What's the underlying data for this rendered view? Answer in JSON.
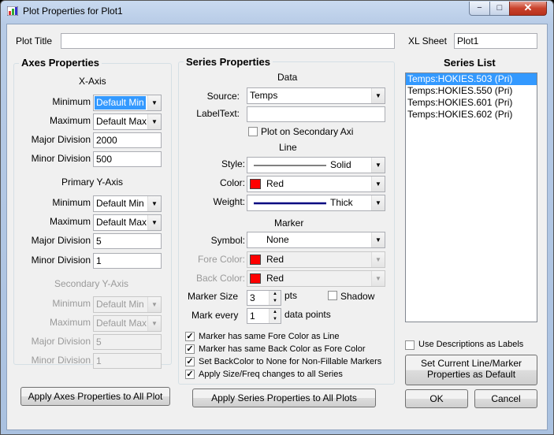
{
  "window": {
    "title": "Plot Properties for Plot1",
    "minimize_glyph": "−",
    "maximize_glyph": "□",
    "close_glyph": "✕"
  },
  "top": {
    "plot_title_label": "Plot Title",
    "plot_title_value": "",
    "xl_sheet_label": "XL Sheet",
    "xl_sheet_value": "Plot1"
  },
  "axes": {
    "group_title": "Axes Properties",
    "x_axis": {
      "heading": "X-Axis",
      "minimum_label": "Minimum",
      "minimum_value": "Default Min",
      "maximum_label": "Maximum",
      "maximum_value": "Default Max",
      "major_label": "Major Division",
      "major_value": "2000",
      "minor_label": "Minor Division",
      "minor_value": "500"
    },
    "primary_y": {
      "heading": "Primary Y-Axis",
      "minimum_label": "Minimum",
      "minimum_value": "Default Min",
      "maximum_label": "Maximum",
      "maximum_value": "Default Max",
      "major_label": "Major Division",
      "major_value": "5",
      "minor_label": "Minor Division",
      "minor_value": "1"
    },
    "secondary_y": {
      "heading": "Secondary Y-Axis",
      "minimum_label": "Minimum",
      "minimum_value": "Default Min",
      "maximum_label": "Maximum",
      "maximum_value": "Default Max",
      "major_label": "Major Division",
      "major_value": "5",
      "minor_label": "Minor Division",
      "minor_value": "1"
    },
    "apply_button": "Apply Axes Properties to All Plot"
  },
  "series": {
    "group_title": "Series Properties",
    "data_heading": "Data",
    "source_label": "Source:",
    "source_value": "Temps",
    "label_text_label": "LabelText:",
    "label_text_value": "",
    "secondary_axis_label": "Plot on Secondary Axi",
    "line_heading": "Line",
    "style_label": "Style:",
    "style_value": "Solid",
    "color_label": "Color:",
    "color_value": "Red",
    "weight_label": "Weight:",
    "weight_value": "Thick",
    "marker_heading": "Marker",
    "symbol_label": "Symbol:",
    "symbol_value": "None",
    "fore_color_label": "Fore Color:",
    "fore_color_value": "Red",
    "back_color_label": "Back Color:",
    "back_color_value": "Red",
    "marker_size_label": "Marker Size",
    "marker_size_value": "3",
    "marker_size_unit": "pts",
    "shadow_label": "Shadow",
    "mark_every_label": "Mark every",
    "mark_every_value": "1",
    "mark_every_unit": "data points",
    "checks": [
      "Marker has same Fore Color as Line",
      "Marker has same Back Color as Fore Color",
      "Set BackColor to None for Non-Fillable Markers",
      "Apply Size/Freq changes to all Series"
    ],
    "apply_button": "Apply Series Properties to All Plots"
  },
  "series_list": {
    "heading": "Series List",
    "items": [
      "Temps:HOKIES.503 (Pri)",
      "Temps:HOKIES.550 (Pri)",
      "Temps:HOKIES.601 (Pri)",
      "Temps:HOKIES.602 (Pri)"
    ],
    "use_descriptions_label": "Use Descriptions as Labels",
    "set_default_line1": "Set Current Line/Marker",
    "set_default_line2": "Properties as Default"
  },
  "buttons": {
    "ok": "OK",
    "cancel": "Cancel"
  },
  "colors": {
    "selection": "#3399ff",
    "swatch_red": "#ff0000",
    "weight_line": "#000080"
  }
}
